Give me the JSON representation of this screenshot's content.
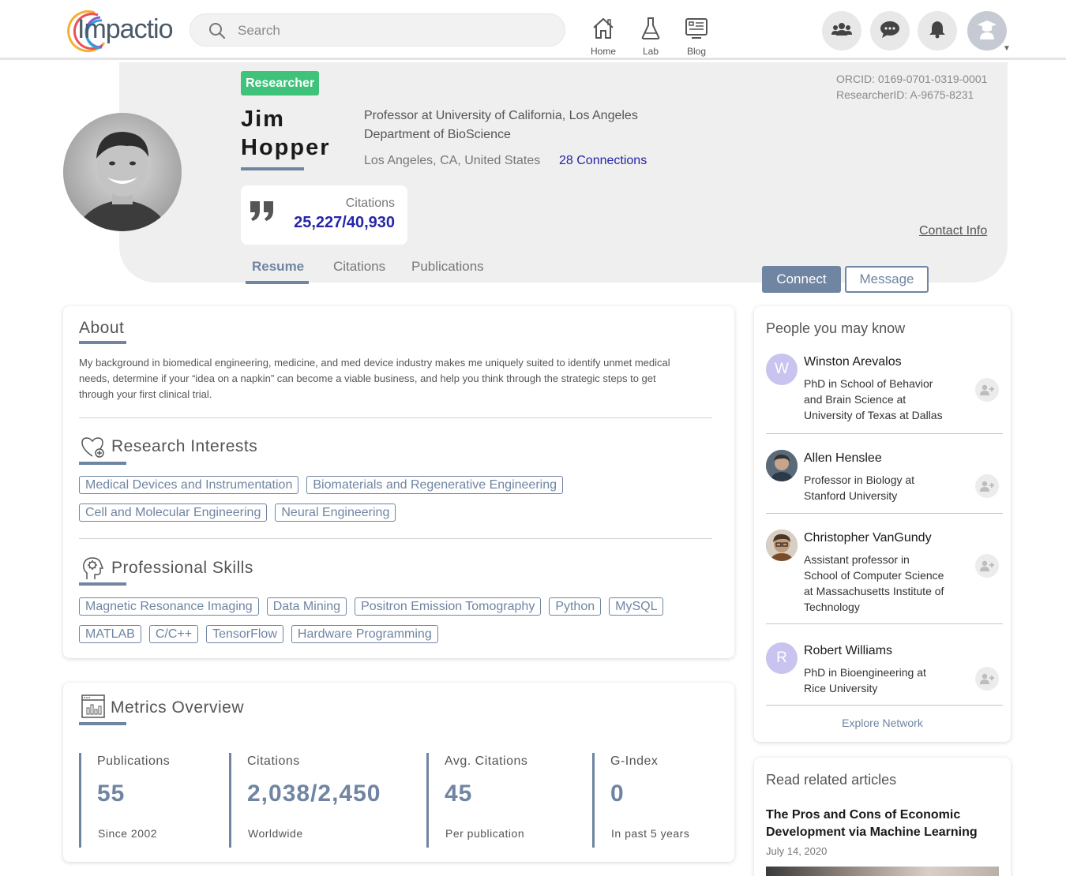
{
  "brand": {
    "logo_text": "Impactio"
  },
  "search": {
    "placeholder": "Search"
  },
  "nav": {
    "home": "Home",
    "lab": "Lab",
    "blog": "Blog"
  },
  "profile": {
    "badge": "Researcher",
    "name": "Jim Hopper",
    "title": "Professor at University of California, Los Angeles",
    "department": "Department of BioScience",
    "location": "Los Angeles, CA, United States",
    "connections": "28 Connections",
    "orcid": "ORCID: 0169-0701-0319-0001",
    "researcher_id": "ResearcherID: A-9675-8231",
    "contact_info": "Contact Info",
    "citations_label": "Citations",
    "citations_value": "25,227/40,930",
    "tabs": [
      "Resume",
      "Citations",
      "Publications"
    ],
    "connect_label": "Connect",
    "message_label": "Message"
  },
  "about": {
    "title": "About",
    "text": "My background in biomedical engineering, medicine, and med device industry makes me uniquely suited to identify unmet medical needs, determine if your “idea on a napkin” can become a viable business, and help you think through the strategic steps to get through your first clinical trial."
  },
  "research_interests": {
    "title": "Research Interests",
    "tags": [
      "Medical Devices and Instrumentation",
      "Biomaterials and Regenerative Engineering",
      "Cell and Molecular Engineering",
      "Neural Engineering"
    ]
  },
  "skills": {
    "title": "Professional Skills",
    "tags": [
      "Magnetic Resonance Imaging",
      "Data Mining",
      "Positron Emission Tomography",
      "Python",
      "MySQL",
      "MATLAB",
      "C/C++",
      "TensorFlow",
      "Hardware Programming"
    ]
  },
  "metrics": {
    "title": "Metrics Overview",
    "items": [
      {
        "label": "Publications",
        "value": "55",
        "sub": "Since 2002"
      },
      {
        "label": "Citations",
        "value": "2,038/2,450",
        "sub": "Worldwide"
      },
      {
        "label": "Avg. Citations",
        "value": "45",
        "sub": "Per publication"
      },
      {
        "label": "G-Index",
        "value": "0",
        "sub": "In past 5 years"
      }
    ]
  },
  "people": {
    "title": "People you may know",
    "items": [
      {
        "initial": "W",
        "name": "Winston Arevalos",
        "desc": "PhD in School of Behavior and Brain Science at University of Texas at Dallas"
      },
      {
        "initial": "",
        "name": "Allen Henslee",
        "desc": "Professor in Biology at Stanford University"
      },
      {
        "initial": "",
        "name": "Christopher VanGundy",
        "desc": "Assistant professor in School of Computer Science at Massachusetts Institute of Technology"
      },
      {
        "initial": "R",
        "name": "Robert Williams",
        "desc": "PhD in Bioengineering at Rice University"
      }
    ],
    "explore": "Explore Network"
  },
  "articles": {
    "title": "Read related articles",
    "headline": "The Pros and Cons of Economic Development via Machine Learning",
    "date": "July 14, 2020"
  },
  "colors": {
    "accent": "#6f85a2",
    "badge": "#3fc27a",
    "link": "#2323a8",
    "initial_avatar": "#c9c3f0"
  },
  "icons": [
    "search-icon",
    "home-icon",
    "flask-icon",
    "blog-icon",
    "people-icon",
    "chat-icon",
    "bell-icon",
    "graduate-icon",
    "quote-icon",
    "heart-plus-icon",
    "gear-head-icon",
    "chart-window-icon",
    "add-person-icon"
  ]
}
